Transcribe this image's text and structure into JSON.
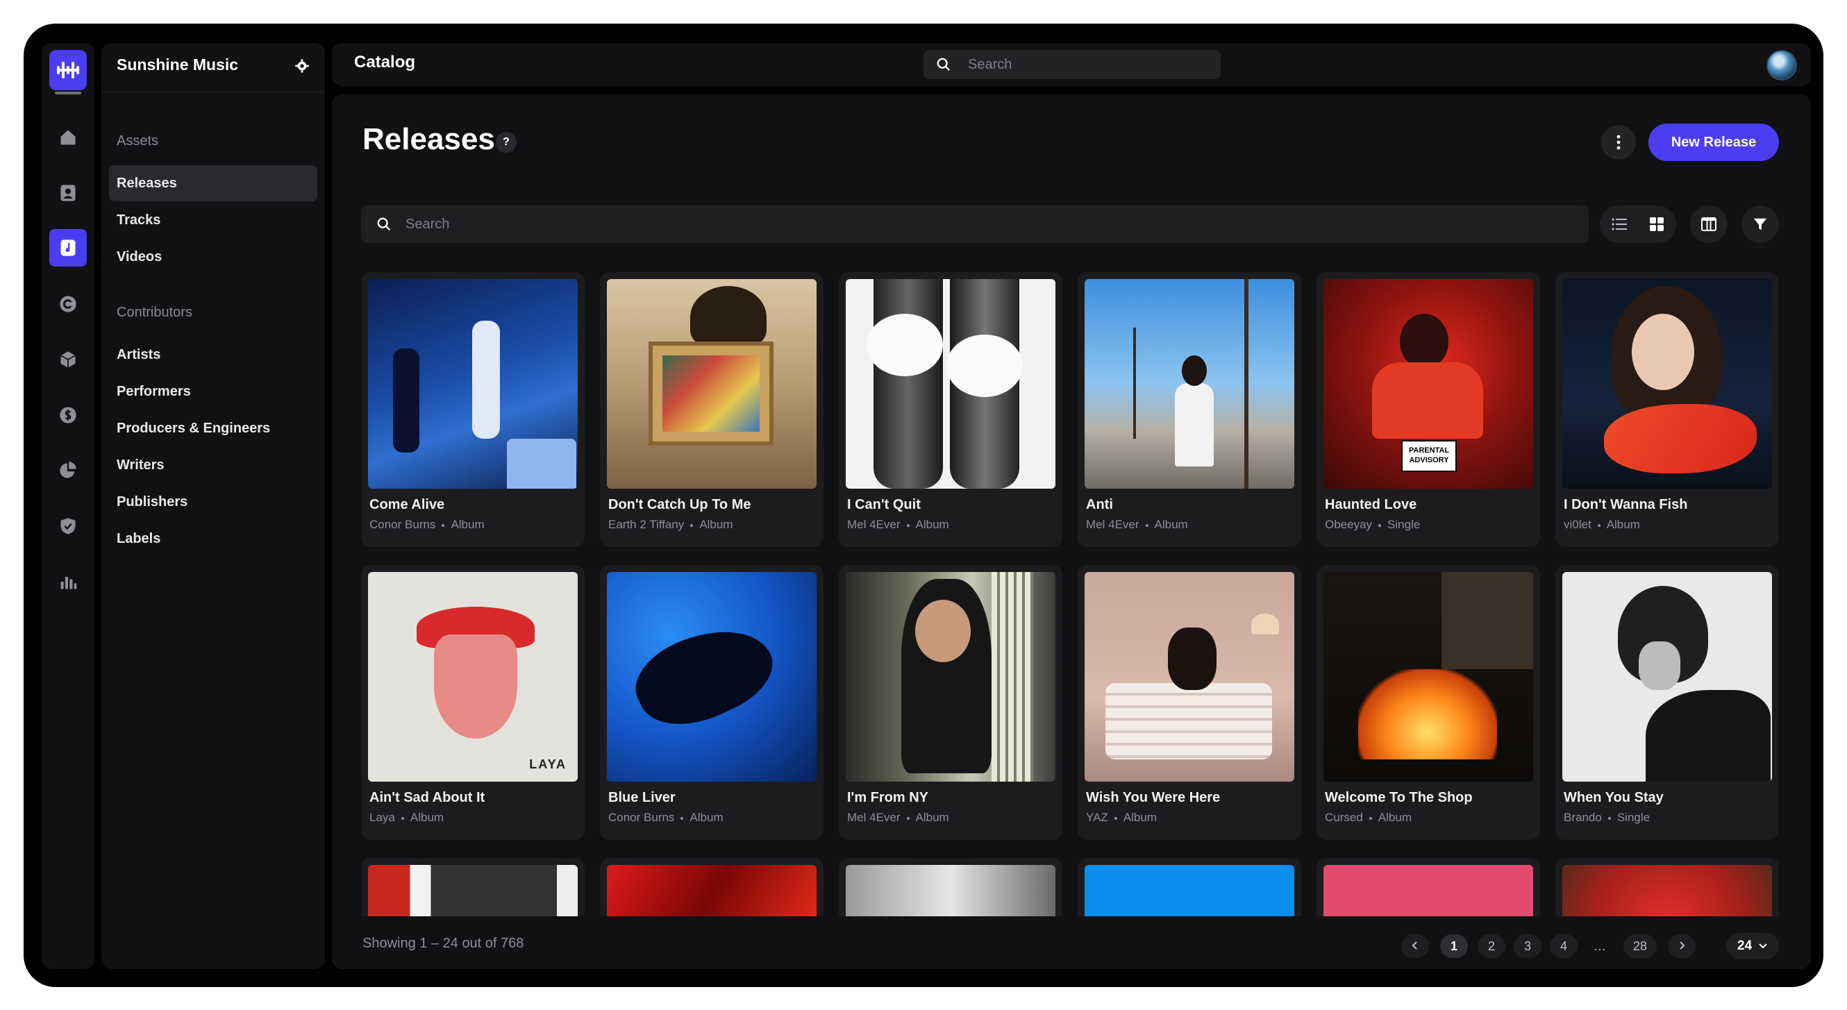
{
  "workspace": {
    "name": "Sunshine Music"
  },
  "topbar": {
    "title": "Catalog",
    "search_placeholder": "Search"
  },
  "sidebar": {
    "assets_heading": "Assets",
    "assets": [
      "Releases",
      "Tracks",
      "Videos"
    ],
    "contributors_heading": "Contributors",
    "contributors": [
      "Artists",
      "Performers",
      "Producers & Engineers",
      "Writers",
      "Publishers",
      "Labels"
    ]
  },
  "rail_icons": [
    "home-icon",
    "contacts-icon",
    "music-file-icon",
    "copyright-icon",
    "box-icon",
    "dollar-icon",
    "pie-chart-icon",
    "shield-icon",
    "bar-chart-icon"
  ],
  "page": {
    "title": "Releases",
    "help": "?",
    "new_button": "New Release",
    "search_placeholder": "Search"
  },
  "releases": [
    {
      "title": "Come Alive",
      "artist": "Conor Burns",
      "type": "Album"
    },
    {
      "title": "Don't Catch Up To Me",
      "artist": "Earth 2 Tiffany",
      "type": "Album"
    },
    {
      "title": "I Can't Quit",
      "artist": "Mel 4Ever",
      "type": "Album"
    },
    {
      "title": "Anti",
      "artist": "Mel 4Ever",
      "type": "Album"
    },
    {
      "title": "Haunted Love",
      "artist": "Obeeyay",
      "type": "Single"
    },
    {
      "title": "I Don't Wanna Fish",
      "artist": "vi0let",
      "type": "Album"
    },
    {
      "title": "Ain't Sad About It",
      "artist": "Laya",
      "type": "Album"
    },
    {
      "title": "Blue Liver",
      "artist": "Conor Burns",
      "type": "Album"
    },
    {
      "title": "I'm From NY",
      "artist": "Mel 4Ever",
      "type": "Album"
    },
    {
      "title": "Wish You Were Here",
      "artist": "YAZ",
      "type": "Album"
    },
    {
      "title": "Welcome To The Shop",
      "artist": "Cursed",
      "type": "Album"
    },
    {
      "title": "When You Stay",
      "artist": "Brando",
      "type": "Single"
    }
  ],
  "art_text": {
    "advisory": "PARENTAL ADVISORY",
    "laya": "LAYA"
  },
  "pagination": {
    "showing": "Showing 1 – 24 out of 768",
    "pages": [
      "1",
      "2",
      "3",
      "4",
      "…",
      "28"
    ],
    "current": "1",
    "per_page": "24"
  },
  "colors": {
    "accent": "#4b3df2",
    "surface": "#111113",
    "card": "#1c1c1f"
  }
}
